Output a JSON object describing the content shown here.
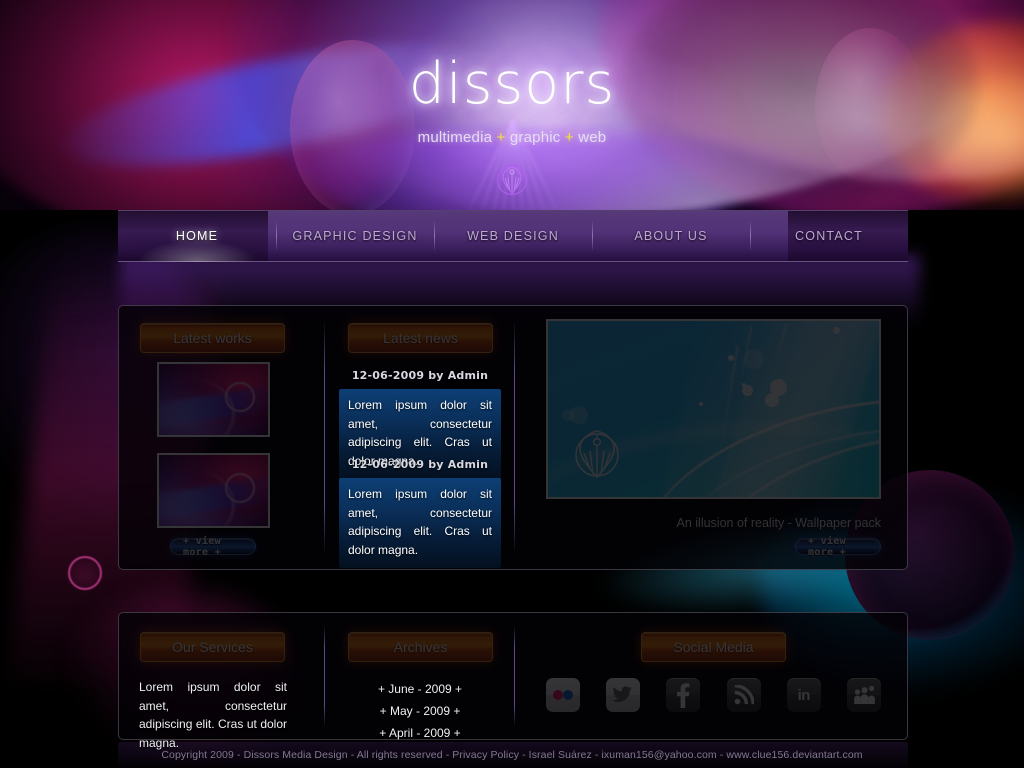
{
  "site": {
    "logo": "dissors",
    "tagline_parts": [
      "multimedia",
      "+",
      "graphic",
      "+",
      "web"
    ],
    "tagline_full": "multimedia + graphic + web",
    "emblem_icon": "dissors-emblem-icon"
  },
  "nav": {
    "items": [
      {
        "label": "HOME",
        "active": true
      },
      {
        "label": "GRAPHIC DESIGN",
        "active": false
      },
      {
        "label": "WEB DESIGN",
        "active": false
      },
      {
        "label": "ABOUT US",
        "active": false
      },
      {
        "label": "CONTACT",
        "active": false
      }
    ]
  },
  "latest_works": {
    "title": "Latest works",
    "thumbnails": [
      {
        "alt": "abstract-purple-magenta-wallpaper-1"
      },
      {
        "alt": "abstract-purple-magenta-wallpaper-2"
      }
    ],
    "view_more": "+ view more +"
  },
  "latest_news": {
    "title": "Latest news",
    "entries": [
      {
        "date": "12-06-2009 by Admin",
        "body": "Lorem ipsum dolor sit amet, consectetur adipiscing elit. Cras ut dolor magna."
      },
      {
        "date": "12-06-2009 by Admin",
        "body": "Lorem ipsum dolor sit amet, consectetur adipiscing elit. Cras ut dolor magna."
      }
    ]
  },
  "feature": {
    "image_alt": "cyan-abstract-wallpaper-with-emblem",
    "caption": "An illusion of reality - Wallpaper pack",
    "view_more": "+ view more +"
  },
  "services": {
    "title": "Our Services",
    "body": "Lorem ipsum dolor sit amet, consectetur adipiscing elit. Cras ut dolor magna."
  },
  "archives": {
    "title": "Archives",
    "items": [
      "+ June - 2009 +",
      "+ May - 2009 +",
      "+ April - 2009 +"
    ]
  },
  "social": {
    "title": "Social Media",
    "icons": [
      {
        "name": "flickr-icon",
        "style": "light"
      },
      {
        "name": "twitter-icon",
        "style": "light"
      },
      {
        "name": "facebook-icon",
        "style": "dark"
      },
      {
        "name": "rss-icon",
        "style": "dark"
      },
      {
        "name": "linkedin-icon",
        "style": "dark"
      },
      {
        "name": "myspace-icon",
        "style": "dark"
      }
    ]
  },
  "footer": {
    "copyright": "Copyright 2009 - Dissors Media Design - All rights reserved - Privacy Policy - Israel Suárez - ixuman156@yahoo.com - www.clue156.deviantart.com"
  },
  "colors": {
    "accent_orange": "#f08b12",
    "accent_blue": "#2f6fc4",
    "tagline_plus": "#f2e23c",
    "feature_cyan": "#2fb5ef",
    "panel_border": "#878296"
  }
}
